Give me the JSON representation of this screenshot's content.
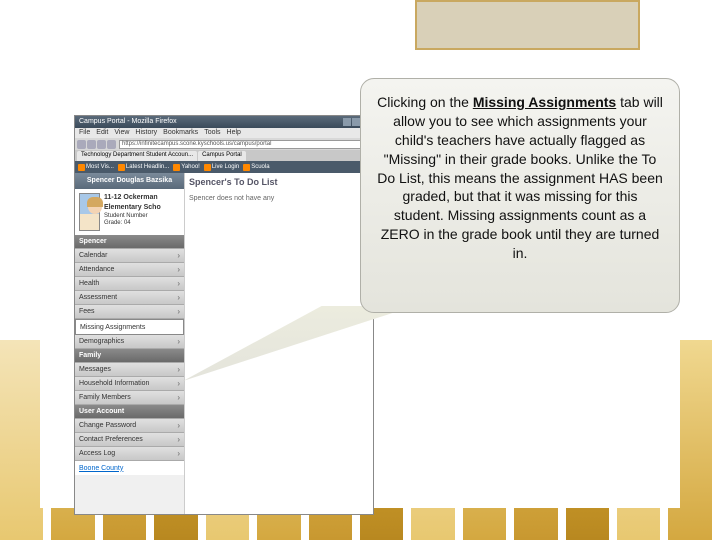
{
  "browser": {
    "title": "Campus Portal - Mozilla Firefox",
    "menu": [
      "File",
      "Edit",
      "View",
      "History",
      "Bookmarks",
      "Tools",
      "Help"
    ],
    "url": "https://infinitecampus.scone.kyschools.us/campus/portal",
    "tabs": [
      "Technology Department Student Accoun...",
      "Campus Portal"
    ],
    "bookmarks": [
      "Most Vis...",
      "Latest Headlin...",
      "Yahoo!",
      "Live Login",
      "Scuola"
    ]
  },
  "student": {
    "banner": "Spencer Douglas Bazsika",
    "line1": "11-12 Ockerman Elementary Scho",
    "line2": "Student Number",
    "line3": "Grade: 04"
  },
  "nav": {
    "headers": [
      "Spencer",
      "Family",
      "User Account"
    ],
    "items1": [
      "Calendar",
      "Attendance",
      "Health",
      "Assessment",
      "Fees"
    ],
    "missing": "Missing Assignments",
    "items2": [
      "Demographics"
    ],
    "items3": [
      "Messages",
      "Household Information",
      "Family Members"
    ],
    "items4": [
      "Change Password",
      "Contact Preferences",
      "Access Log"
    ],
    "link": "Boone County"
  },
  "main": {
    "title": "Spencer's To Do List",
    "text": "Spencer does not have any"
  },
  "callout": {
    "pre": "Clicking on the ",
    "bold": "Missing Assignments",
    "post": " tab will allow you to see which assignments your child's teachers have actually flagged as \"Missing\" in their grade books.  Unlike the To Do List, this means the assignment HAS been graded, but that it was missing for this student.  Missing assignments count as a ZERO in the grade book until they are turned in."
  }
}
